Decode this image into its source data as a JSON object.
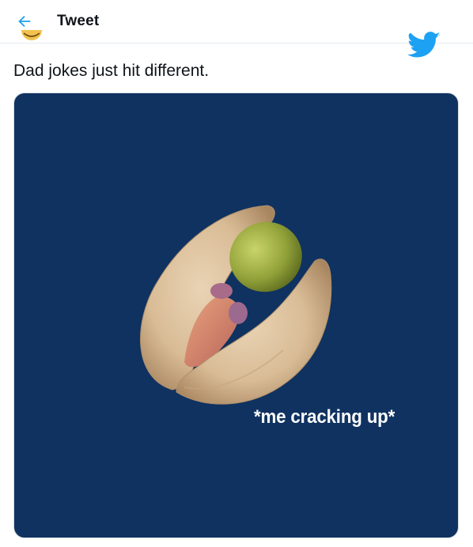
{
  "header": {
    "title": "Tweet"
  },
  "tweet": {
    "text": "Dad jokes just hit different.",
    "image": {
      "description_icon": "pistachio-image",
      "caption": "*me cracking up*"
    }
  },
  "colors": {
    "accent": "#1da1f2",
    "image_background": "#0f3260",
    "text": "#0f1419"
  },
  "icons": {
    "back": "arrow-left-icon",
    "brand": "twitter-bird-icon"
  }
}
